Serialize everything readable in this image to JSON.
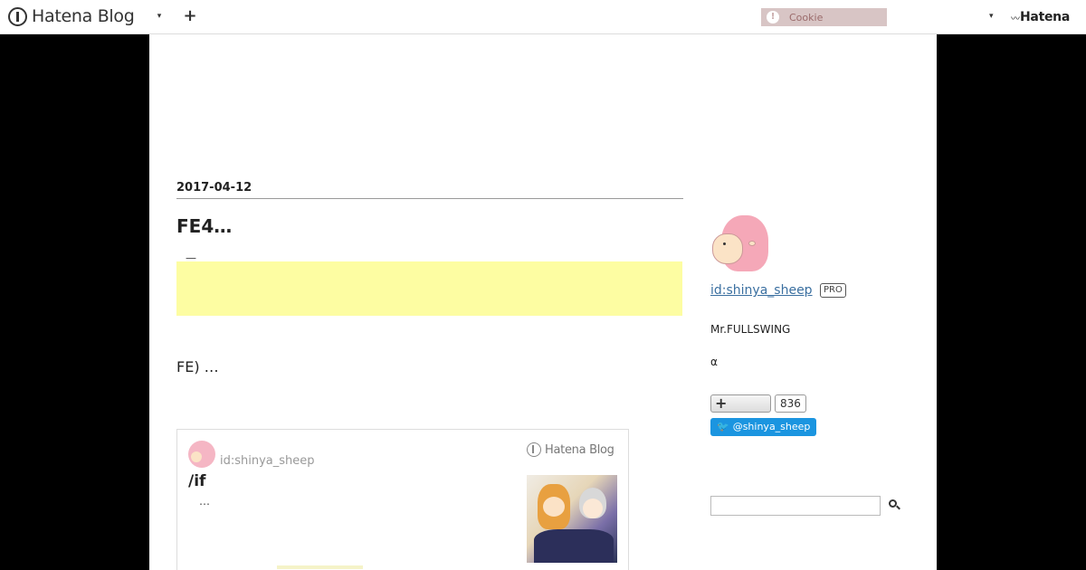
{
  "header": {
    "logo_text": "Hatena Blog",
    "dropdown_icon": "▾",
    "add_icon": "+",
    "cookie_icon": "!",
    "cookie_text": "Cookie",
    "right_dropdown_icon": "▾",
    "hatena_logo_text": "Hatena"
  },
  "entry": {
    "date": "2017-04-12",
    "title": "FE4…",
    "dash": "—",
    "text": "FE) …"
  },
  "card": {
    "author_id": "id:shinya_sheep",
    "logo_text": "Hatena Blog",
    "title": "/if",
    "description": "…"
  },
  "sidebar": {
    "profile_id": "id:shinya_sheep",
    "pro_badge": "PRO",
    "desc1": "Mr.FULLSWING",
    "desc2": "α",
    "reader_plus": "+",
    "reader_count": "836",
    "twitter_label": "@shinya_sheep",
    "twitter_icon": "bird-icon",
    "search_placeholder": ""
  },
  "colors": {
    "background": "#000000",
    "ad_yellow": "#fdfda2",
    "link_blue": "#3a6fa0",
    "twitter_blue": "#1b95e0",
    "cookie_bar": "#d8c5c5",
    "sheep_pink": "#f5a8b8"
  }
}
